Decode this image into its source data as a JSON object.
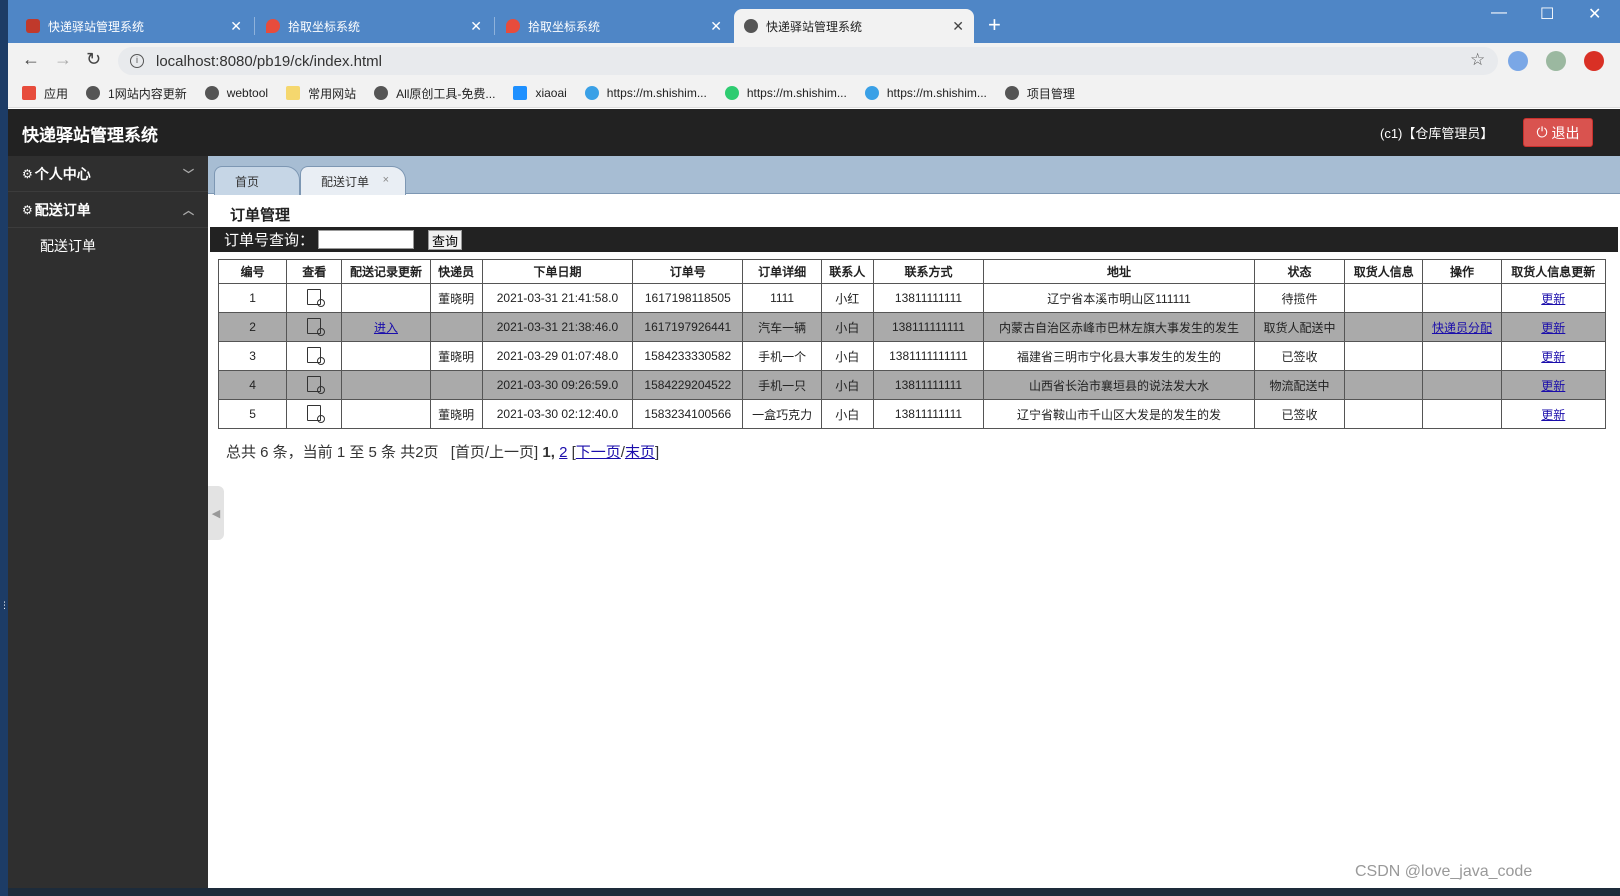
{
  "browser": {
    "tabs": [
      {
        "title": "快递驿站管理系统",
        "favicon_color": "#c0392b",
        "active": false
      },
      {
        "title": "拾取坐标系统",
        "favicon_color": "#e74c3c",
        "active": false
      },
      {
        "title": "拾取坐标系统",
        "favicon_color": "#e74c3c",
        "active": false
      },
      {
        "title": "快递驿站管理系统",
        "favicon_color": "#555555",
        "active": true
      }
    ],
    "new_tab": "+",
    "url": "localhost:8080/pb19/ck/index.html",
    "bookmarks": [
      {
        "label": "应用",
        "icon": "apps-grid-icon",
        "color": "#e74c3c"
      },
      {
        "label": "1网站内容更新",
        "icon": "globe-icon",
        "color": "#555555"
      },
      {
        "label": "webtool",
        "icon": "globe-icon",
        "color": "#555555"
      },
      {
        "label": "常用网站",
        "icon": "folder-icon",
        "color": "#f5d76e"
      },
      {
        "label": "All原创工具-免费...",
        "icon": "globe-icon",
        "color": "#555555"
      },
      {
        "label": "xiaoai",
        "icon": "p-icon",
        "color": "#1e90ff"
      },
      {
        "label": "https://m.shishim...",
        "icon": "c-icon",
        "color": "#3aa0e6"
      },
      {
        "label": "https://m.shishim...",
        "icon": "wechat-icon",
        "color": "#2ecc71"
      },
      {
        "label": "https://m.shishim...",
        "icon": "c-icon",
        "color": "#3aa0e6"
      },
      {
        "label": "项目管理",
        "icon": "globe-icon",
        "color": "#555555"
      }
    ]
  },
  "app": {
    "title": "快递驿站管理系统",
    "user": "(c1)【仓库管理员】",
    "logout_label": "退出",
    "sidebar": {
      "groups": [
        {
          "label": "个人中心",
          "expanded": false
        },
        {
          "label": "配送订单",
          "expanded": true
        }
      ],
      "items": [
        {
          "label": "配送订单"
        }
      ]
    },
    "content_tabs": [
      {
        "label": "首页"
      },
      {
        "label": "配送订单",
        "close": "×"
      }
    ],
    "page_heading": "订单管理",
    "search": {
      "label": "订单号查询：",
      "value": "",
      "button": "查询"
    },
    "table": {
      "headers": [
        "编号",
        "查看",
        "配送记录更新",
        "快递员",
        "下单日期",
        "订单号",
        "订单详细",
        "联系人",
        "联系方式",
        "地址",
        "状态",
        "取货人信息",
        "操作",
        "取货人信息更新"
      ],
      "rows": [
        {
          "id": "1",
          "record_update": "",
          "courier": "董晓明",
          "date": "2021-03-31 21:41:58.0",
          "order_no": "1617198118505",
          "detail": "1111",
          "contact": "小红",
          "phone": "13811111111",
          "address": "辽宁省本溪市明山区111111",
          "status": "待揽件",
          "pickup_info": "",
          "action": "",
          "pickup_update": "更新"
        },
        {
          "id": "2",
          "record_update": "进入",
          "courier": "",
          "date": "2021-03-31 21:38:46.0",
          "order_no": "1617197926441",
          "detail": "汽车一辆",
          "contact": "小白",
          "phone": "138111111111",
          "address": "内蒙古自治区赤峰市巴林左旗大事发生的发生",
          "status": "取货人配送中",
          "pickup_info": "",
          "action": "快递员分配",
          "pickup_update": "更新"
        },
        {
          "id": "3",
          "record_update": "",
          "courier": "董晓明",
          "date": "2021-03-29 01:07:48.0",
          "order_no": "1584233330582",
          "detail": "手机一个",
          "contact": "小白",
          "phone": "1381111111111",
          "address": "福建省三明市宁化县大事发生的发生的",
          "status": "已签收",
          "pickup_info": "",
          "action": "",
          "pickup_update": "更新"
        },
        {
          "id": "4",
          "record_update": "",
          "courier": "",
          "date": "2021-03-30 09:26:59.0",
          "order_no": "1584229204522",
          "detail": "手机一只",
          "contact": "小白",
          "phone": "13811111111",
          "address": "山西省长治市襄垣县的说法发大水",
          "status": "物流配送中",
          "pickup_info": "",
          "action": "",
          "pickup_update": "更新"
        },
        {
          "id": "5",
          "record_update": "",
          "courier": "董晓明",
          "date": "2021-03-30 02:12:40.0",
          "order_no": "1583234100566",
          "detail": "一盒巧克力",
          "contact": "小白",
          "phone": "13811111111",
          "address": "辽宁省鞍山市千山区大发是的发生的发",
          "status": "已签收",
          "pickup_info": "",
          "action": "",
          "pickup_update": "更新"
        }
      ]
    },
    "pager": {
      "summary": "总共 6 条，当前 1 至 5 条 共2页",
      "first_prev": "[首页/上一页]",
      "current": "1,",
      "page2": "2",
      "open": "[",
      "next": "下一页",
      "slash": "/",
      "last": "末页",
      "close": "]"
    }
  },
  "watermark": "CSDN @love_java_code"
}
